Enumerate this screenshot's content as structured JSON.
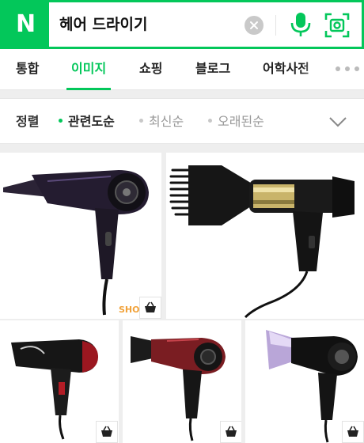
{
  "search": {
    "logo": "N",
    "query": "헤어 드라이기"
  },
  "tabs": [
    {
      "label": "통합"
    },
    {
      "label": "이미지",
      "active": true
    },
    {
      "label": "쇼핑"
    },
    {
      "label": "블로그"
    },
    {
      "label": "어학사전"
    }
  ],
  "sort": {
    "title": "정렬",
    "options": [
      {
        "label": "관련도순",
        "active": true
      },
      {
        "label": "최신순"
      },
      {
        "label": "오래된순"
      }
    ]
  },
  "images": [
    {
      "watermark": "SHO",
      "shop_icon": "shopping-basket-icon"
    },
    {},
    {
      "shop_icon": "shopping-basket-icon"
    },
    {
      "shop_icon": "shopping-basket-icon"
    },
    {
      "shop_icon": "shopping-basket-icon"
    }
  ],
  "colors": {
    "brand_green": "#03c75a",
    "active_text": "#03c75a"
  }
}
